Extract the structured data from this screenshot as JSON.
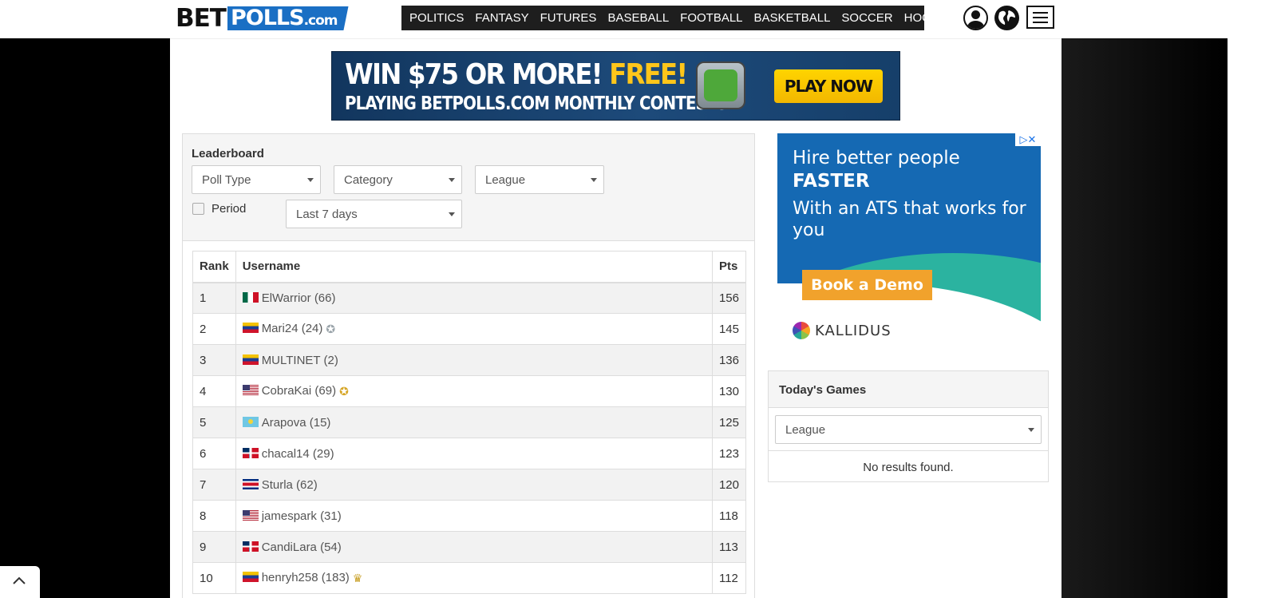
{
  "header": {
    "logo_bet": "BET",
    "logo_polls": "POLLS",
    "logo_com": ".com",
    "nav": [
      "POLITICS",
      "FANTASY",
      "FUTURES",
      "BASEBALL",
      "FOOTBALL",
      "BASKETBALL",
      "SOCCER",
      "HOCKEY"
    ],
    "icons": [
      "user-icon",
      "globe-icon",
      "hamburger-menu-icon"
    ]
  },
  "banner": {
    "line1_a": "WIN $75 OR MORE! ",
    "line1_b": "FREE!",
    "line2": "PLAYING BETPOLLS.COM MONTHLY CONTESTS",
    "cta": "PLAY NOW",
    "colors": {
      "background": "#1d4a7a",
      "accent": "#ffc61a"
    }
  },
  "leaderboard": {
    "title": "Leaderboard",
    "filters": {
      "poll_type": "Poll Type",
      "category": "Category",
      "league": "League",
      "period_label": "Period",
      "period_checked": false,
      "range": "Last 7 days"
    },
    "columns": {
      "rank": "Rank",
      "username": "Username",
      "pts": "Pts"
    },
    "rows": [
      {
        "rank": "1",
        "flag": "mx",
        "name": "ElWarrior",
        "count": "(66)",
        "medal": "",
        "pts": "156"
      },
      {
        "rank": "2",
        "flag": "ve",
        "name": "Mari24",
        "count": "(24)",
        "medal": "silver",
        "pts": "145"
      },
      {
        "rank": "3",
        "flag": "ve",
        "name": "MULTINET",
        "count": "(2)",
        "medal": "",
        "pts": "136"
      },
      {
        "rank": "4",
        "flag": "us",
        "name": "CobraKai",
        "count": "(69)",
        "medal": "gold",
        "pts": "130"
      },
      {
        "rank": "5",
        "flag": "kz",
        "name": "Arapova",
        "count": "(15)",
        "medal": "",
        "pts": "125"
      },
      {
        "rank": "6",
        "flag": "do",
        "name": "chacal14",
        "count": "(29)",
        "medal": "",
        "pts": "123"
      },
      {
        "rank": "7",
        "flag": "cr",
        "name": "Sturla",
        "count": "(62)",
        "medal": "",
        "pts": "120"
      },
      {
        "rank": "8",
        "flag": "us",
        "name": "jamespark",
        "count": "(31)",
        "medal": "",
        "pts": "118"
      },
      {
        "rank": "9",
        "flag": "do",
        "name": "CandiLara",
        "count": "(54)",
        "medal": "",
        "pts": "113"
      },
      {
        "rank": "10",
        "flag": "ve",
        "name": "henryh258",
        "count": "(183)",
        "medal": "trophy",
        "pts": "112"
      }
    ]
  },
  "ad": {
    "line1": "Hire better people",
    "line2": "FASTER",
    "line3": "With an ATS that works for you",
    "cta": "Book a Demo",
    "brand": "KALLIDUS",
    "colors": {
      "background": "#1569b3",
      "wave": "#2bb3a0",
      "cta": "#f1a22c"
    }
  },
  "games": {
    "title": "Today's Games",
    "league": "League",
    "empty": "No results found."
  },
  "back_to_top_icon": "chevron-up-icon"
}
